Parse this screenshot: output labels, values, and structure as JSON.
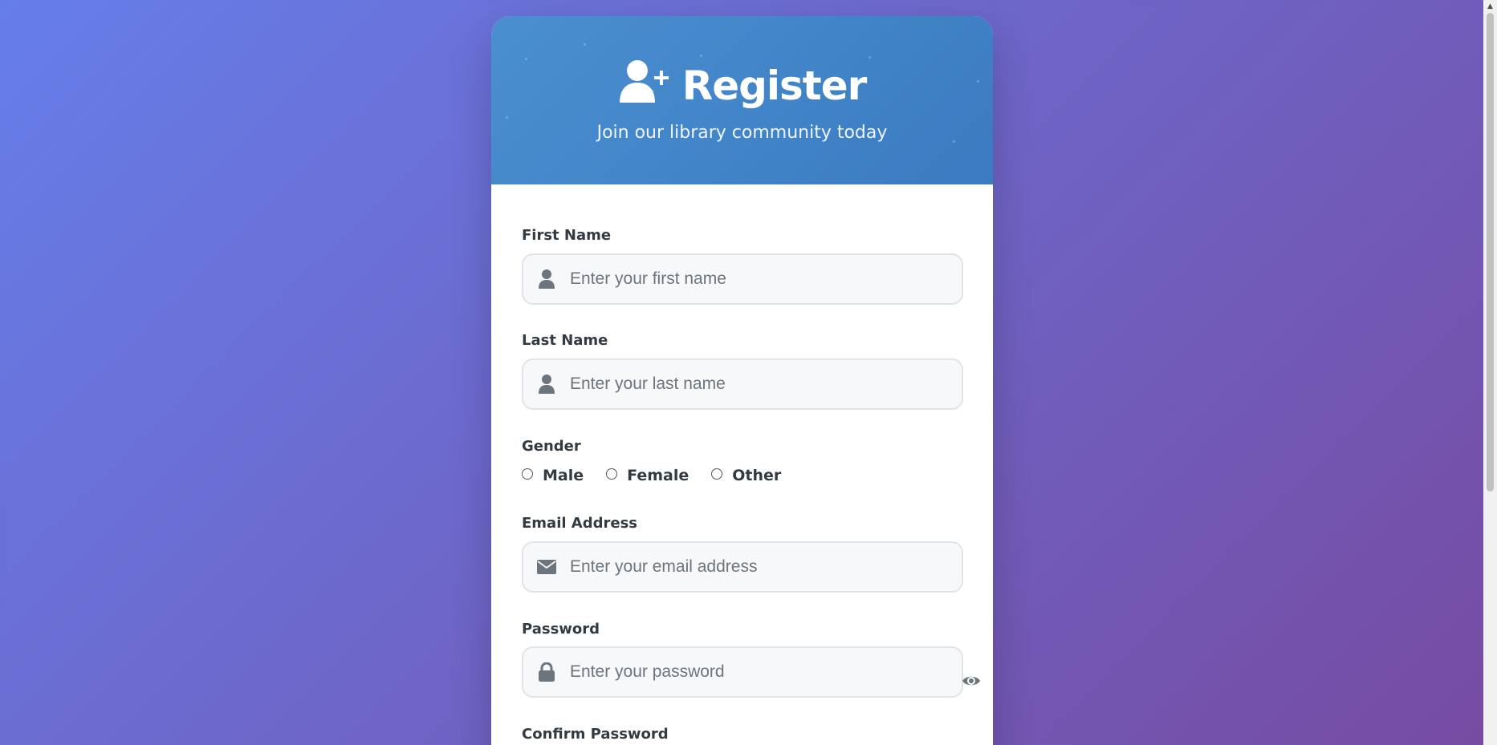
{
  "header": {
    "title": "Register",
    "subtitle": "Join our library community today"
  },
  "form": {
    "first_name": {
      "label": "First Name",
      "placeholder": "Enter your first name",
      "icon": "user-icon"
    },
    "last_name": {
      "label": "Last Name",
      "placeholder": "Enter your last name",
      "icon": "user-icon"
    },
    "gender": {
      "label": "Gender",
      "options": [
        "Male",
        "Female",
        "Other"
      ]
    },
    "email": {
      "label": "Email Address",
      "placeholder": "Enter your email address",
      "icon": "envelope-icon"
    },
    "password": {
      "label": "Password",
      "placeholder": "Enter your password",
      "icon": "lock-icon",
      "toggle_icon": "eye-icon"
    },
    "confirm_password": {
      "label": "Confirm Password"
    }
  },
  "colors": {
    "background_start": "#667eea",
    "background_end": "#764ba2",
    "header": "#3f86c8",
    "icon": "#6c757d"
  }
}
